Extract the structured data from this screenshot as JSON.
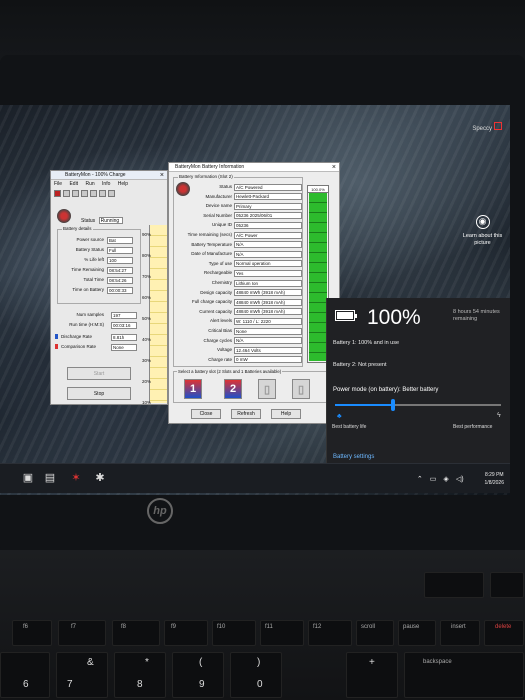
{
  "desktop": {
    "learn_picture": "Learn about this picture",
    "top_badge": "Speccy"
  },
  "batterymon": {
    "title": "BatteryMon - 100% Charge",
    "menu": [
      "File",
      "Edit",
      "Run",
      "Info",
      "Help"
    ],
    "status_label": "Status",
    "status_value": "Running",
    "details_group": "Battery details",
    "fields": [
      {
        "label": "Power source",
        "value": "Bat"
      },
      {
        "label": "Battery Status",
        "value": "Full"
      },
      {
        "label": "% Life left",
        "value": "100"
      },
      {
        "label": "Time Remaining",
        "value": "08:54:27"
      },
      {
        "label": "Total Time",
        "value": "08:54:26"
      },
      {
        "label": "Time on Battery",
        "value": "00:00:33"
      }
    ],
    "num_samples_label": "Num samples",
    "num_samples_value": "197",
    "run_time_label": "Run time (H:M:S)",
    "run_time_value": "00:03:16",
    "discharge_label": "Discharge Rate",
    "discharge_value": "8.81h",
    "comparison_label": "Comparison Rate",
    "comparison_value": "None",
    "start_button": "Start",
    "stop_button": "Stop",
    "percent_ticks": [
      "90%",
      "80%",
      "70%",
      "60%",
      "50%",
      "40%",
      "30%",
      "20%",
      "10%"
    ]
  },
  "battery_info": {
    "title": "BatteryMon Battery Information",
    "group_label": "Battery Information (Slot 2)",
    "rows": [
      {
        "label": "Status",
        "value": "A/C Powered"
      },
      {
        "label": "Manufacturer",
        "value": "Hewlett-Packard"
      },
      {
        "label": "Device name",
        "value": "Primary"
      },
      {
        "label": "Serial Number",
        "value": "05236 2025/06/01"
      },
      {
        "label": "Unique ID",
        "value": "05236"
      },
      {
        "label": "Time remaining (secs)",
        "value": "A/C Power"
      },
      {
        "label": "Battery Temperature",
        "value": "N/A"
      },
      {
        "label": "Date of Manufacture",
        "value": "N/A"
      },
      {
        "label": "Type of use",
        "value": "Normal operation"
      },
      {
        "label": "Rechargeable",
        "value": "Yes"
      },
      {
        "label": "Chemistry",
        "value": "Lithium Ion"
      },
      {
        "label": "Design capacity",
        "value": "48840 mWh (3918 mAh)"
      },
      {
        "label": "Full charge capacity",
        "value": "48840 mWh (3918 mAh)"
      },
      {
        "label": "Current capacity",
        "value": "48840 mWh (3918 mAh)"
      },
      {
        "label": "Alert levels",
        "value": "W: 1110 / L: 2220"
      },
      {
        "label": "Critical Bias",
        "value": "None"
      },
      {
        "label": "Charge cycles",
        "value": "N/A"
      },
      {
        "label": "Voltage",
        "value": "12.464 Volts"
      },
      {
        "label": "Charge rate",
        "value": "0 mW"
      }
    ],
    "level_label": "100.0%",
    "level_fraction": 1.0,
    "slots_label": "Select a battery slot (2 Slots and 1 Batteries available)",
    "slots": [
      {
        "label": "1",
        "state": "on"
      },
      {
        "label": "2",
        "state": "on"
      },
      {
        "label": "",
        "state": "off"
      },
      {
        "label": "",
        "state": "off"
      }
    ],
    "close_button": "Close",
    "refresh_button": "Refresh",
    "help_button": "Help"
  },
  "flyout": {
    "percent": "100%",
    "percent_fraction": 1.0,
    "remaining": "8 hours 54 minutes remaining",
    "battery1": "Battery 1: 100% and in use",
    "battery2": "Battery 2: Not present",
    "mode": "Power mode (on battery): Better battery",
    "slider_fraction": 0.35,
    "best_life": "Best battery life",
    "best_perf": "Best performance",
    "settings": "Battery settings"
  },
  "taskbar": {
    "time": "8:29 PM",
    "date": "1/8/2026"
  },
  "keyboard": {
    "brand": "hp",
    "fn_row": [
      "f6",
      "f7",
      "f8",
      "f9",
      "f10",
      "f11",
      "f12",
      "scroll",
      "pause",
      "insert",
      "delete"
    ],
    "num_row": [
      "6",
      "7",
      "8",
      "9",
      "0"
    ],
    "num_row_sym": [
      "&",
      "*",
      "(",
      ")",
      "+"
    ],
    "backspace": "backspace"
  },
  "colors": {
    "accent": "#1a8cff",
    "battery_green": "#2dbb2d",
    "flyout_bg": "#202124"
  }
}
